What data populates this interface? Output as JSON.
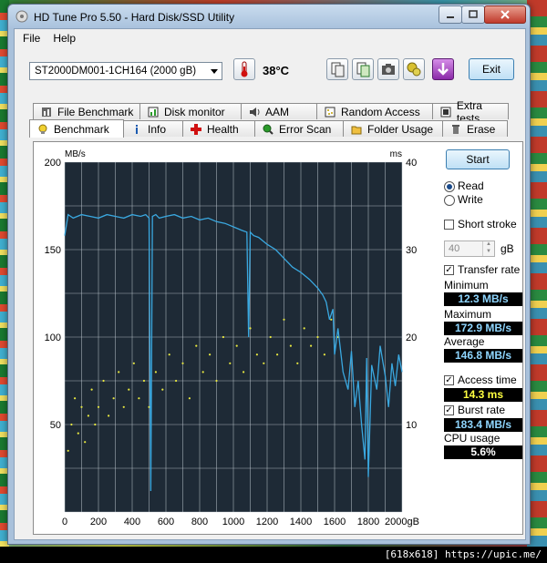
{
  "window": {
    "title": "HD Tune Pro 5.50 - Hard Disk/SSD Utility"
  },
  "menu": {
    "items": [
      "File",
      "Help"
    ]
  },
  "toolbar": {
    "drive": "ST2000DM001-1CH164 (2000 gB)",
    "temperature": "38",
    "temperature_unit": "°C",
    "exit_label": "Exit",
    "buttons": [
      "copy-text-icon",
      "copy-info-icon",
      "screenshot-icon",
      "options-icon",
      "save-down-icon"
    ]
  },
  "tabs_top": [
    {
      "label": "File Benchmark",
      "icon": "file-benchmark-icon"
    },
    {
      "label": "Disk monitor",
      "icon": "disk-monitor-icon"
    },
    {
      "label": "AAM",
      "icon": "speaker-icon"
    },
    {
      "label": "Random Access",
      "icon": "random-access-icon"
    },
    {
      "label": "Extra tests",
      "icon": "extra-tests-icon"
    }
  ],
  "tabs_bottom": [
    {
      "label": "Benchmark",
      "icon": "benchmark-icon",
      "active": true
    },
    {
      "label": "Info",
      "icon": "info-icon"
    },
    {
      "label": "Health",
      "icon": "health-icon"
    },
    {
      "label": "Error Scan",
      "icon": "error-scan-icon"
    },
    {
      "label": "Folder Usage",
      "icon": "folder-icon"
    },
    {
      "label": "Erase",
      "icon": "trash-icon"
    }
  ],
  "side": {
    "start_label": "Start",
    "read_label": "Read",
    "write_label": "Write",
    "short_stroke_label": "Short stroke",
    "short_stroke_value": "40",
    "short_stroke_unit": "gB",
    "transfer_rate_label": "Transfer rate",
    "minimum_label": "Minimum",
    "minimum_value": "12.3 MB/s",
    "maximum_label": "Maximum",
    "maximum_value": "172.9 MB/s",
    "average_label": "Average",
    "average_value": "146.8 MB/s",
    "access_time_label": "Access time",
    "access_time_value": "14.3 ms",
    "burst_rate_label": "Burst rate",
    "burst_rate_value": "183.4 MB/s",
    "cpu_label": "CPU usage",
    "cpu_value": "5.6%"
  },
  "chart_data": {
    "type": "line",
    "left_unit": "MB/s",
    "right_unit": "ms",
    "y_ticks_left": [
      "200",
      "150",
      "100",
      "50"
    ],
    "y_ticks_right": [
      "40",
      "30",
      "20",
      "10"
    ],
    "x_ticks": [
      "0",
      "200",
      "400",
      "600",
      "800",
      "1000",
      "1200",
      "1400",
      "1600",
      "1800",
      "2000gB"
    ],
    "xlim": [
      0,
      2000
    ],
    "ylim_left": [
      0,
      200
    ],
    "ylim_right": [
      0,
      40
    ],
    "grid": true,
    "series": [
      {
        "color": "#3aa8e0",
        "axis": "left",
        "x": [
          0,
          20,
          50,
          100,
          150,
          200,
          250,
          300,
          350,
          400,
          450,
          480,
          500,
          510,
          520,
          540,
          560,
          600,
          650,
          700,
          750,
          800,
          850,
          900,
          950,
          1000,
          1050,
          1080,
          1090,
          1100,
          1120,
          1150,
          1200,
          1250,
          1300,
          1350,
          1400,
          1450,
          1500,
          1530,
          1550,
          1570,
          1590,
          1600,
          1620,
          1650,
          1680,
          1700,
          1720,
          1740,
          1760,
          1780,
          1790,
          1800,
          1820,
          1850,
          1870,
          1900,
          1920,
          1940,
          1960,
          1980,
          2000
        ],
        "y": [
          158,
          170,
          168,
          170,
          169,
          168,
          170,
          169,
          168,
          170,
          169,
          170,
          168,
          12,
          169,
          170,
          168,
          169,
          170,
          168,
          169,
          167,
          168,
          166,
          165,
          163,
          161,
          160,
          100,
          160,
          158,
          157,
          153,
          150,
          145,
          140,
          137,
          133,
          128,
          124,
          120,
          110,
          116,
          90,
          105,
          80,
          70,
          92,
          60,
          75,
          50,
          30,
          88,
          20,
          84,
          70,
          95,
          78,
          60,
          85,
          72,
          90,
          80
        ]
      },
      {
        "color": "#e8e840",
        "axis": "right",
        "style": "scatter",
        "x": [
          20,
          40,
          60,
          80,
          100,
          120,
          140,
          160,
          180,
          200,
          230,
          260,
          290,
          320,
          350,
          380,
          410,
          440,
          470,
          500,
          540,
          580,
          620,
          660,
          700,
          740,
          780,
          820,
          860,
          900,
          940,
          980,
          1020,
          1060,
          1100,
          1140,
          1180,
          1220,
          1260,
          1300,
          1340,
          1380,
          1420,
          1460,
          1500,
          1540,
          1580,
          1620
        ],
        "y": [
          7,
          10,
          13,
          9,
          12,
          8,
          11,
          14,
          10,
          12,
          15,
          11,
          13,
          16,
          12,
          14,
          17,
          13,
          15,
          12,
          16,
          14,
          18,
          15,
          17,
          13,
          19,
          16,
          18,
          15,
          20,
          17,
          19,
          16,
          21,
          18,
          17,
          20,
          18,
          22,
          19,
          17,
          21,
          19,
          20,
          18,
          22,
          20
        ]
      }
    ]
  }
}
